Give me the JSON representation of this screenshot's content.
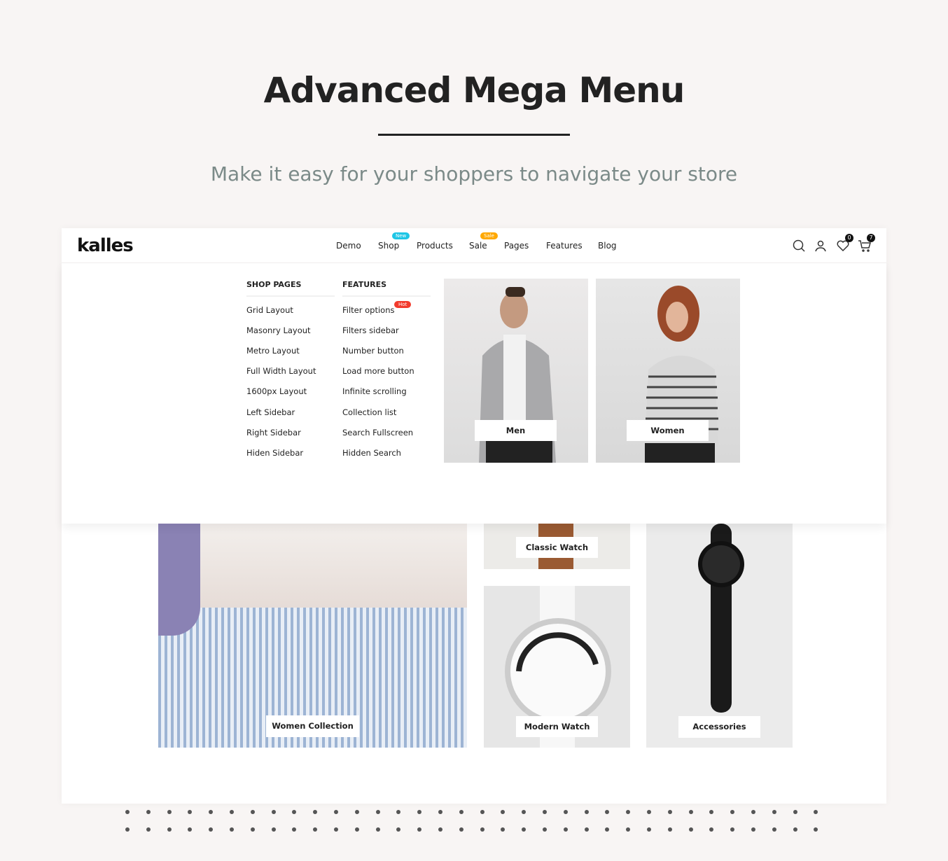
{
  "hero": {
    "title": "Advanced Mega Menu",
    "subtitle": "Make it easy for your shoppers to navigate your store"
  },
  "header": {
    "logo": "kalles",
    "nav": [
      {
        "label": "Demo"
      },
      {
        "label": "Shop",
        "badge": "New",
        "badge_color": "#1ec6e6"
      },
      {
        "label": "Products"
      },
      {
        "label": "Sale",
        "badge": "Sale",
        "badge_color": "#ffa800"
      },
      {
        "label": "Pages"
      },
      {
        "label": "Features"
      },
      {
        "label": "Blog"
      }
    ],
    "icons": {
      "search": "search-icon",
      "account": "user-icon",
      "wishlist": "heart-icon",
      "cart": "cart-icon"
    },
    "wishlist_count": "0",
    "cart_count": "7"
  },
  "megamenu": {
    "shop_pages": {
      "heading": "SHOP PAGES",
      "items": [
        "Grid Layout",
        "Masonry Layout",
        "Metro Layout",
        "Full Width Layout",
        "1600px Layout",
        "Left Sidebar",
        "Right Sidebar",
        "Hiden Sidebar"
      ]
    },
    "features": {
      "heading": "FEATURES",
      "items": [
        "Filter options",
        "Filters sidebar",
        "Number button",
        "Load more button",
        "Infinite scrolling",
        "Collection list",
        "Search Fullscreen",
        "Hidden Search"
      ],
      "hot_badge": "Hot"
    },
    "promos": [
      {
        "label": "Men"
      },
      {
        "label": "Women"
      }
    ]
  },
  "collections": [
    {
      "label": "Women Collection"
    },
    {
      "label": "Classic Watch"
    },
    {
      "label": "Modern Watch"
    },
    {
      "label": "Accessories"
    }
  ]
}
